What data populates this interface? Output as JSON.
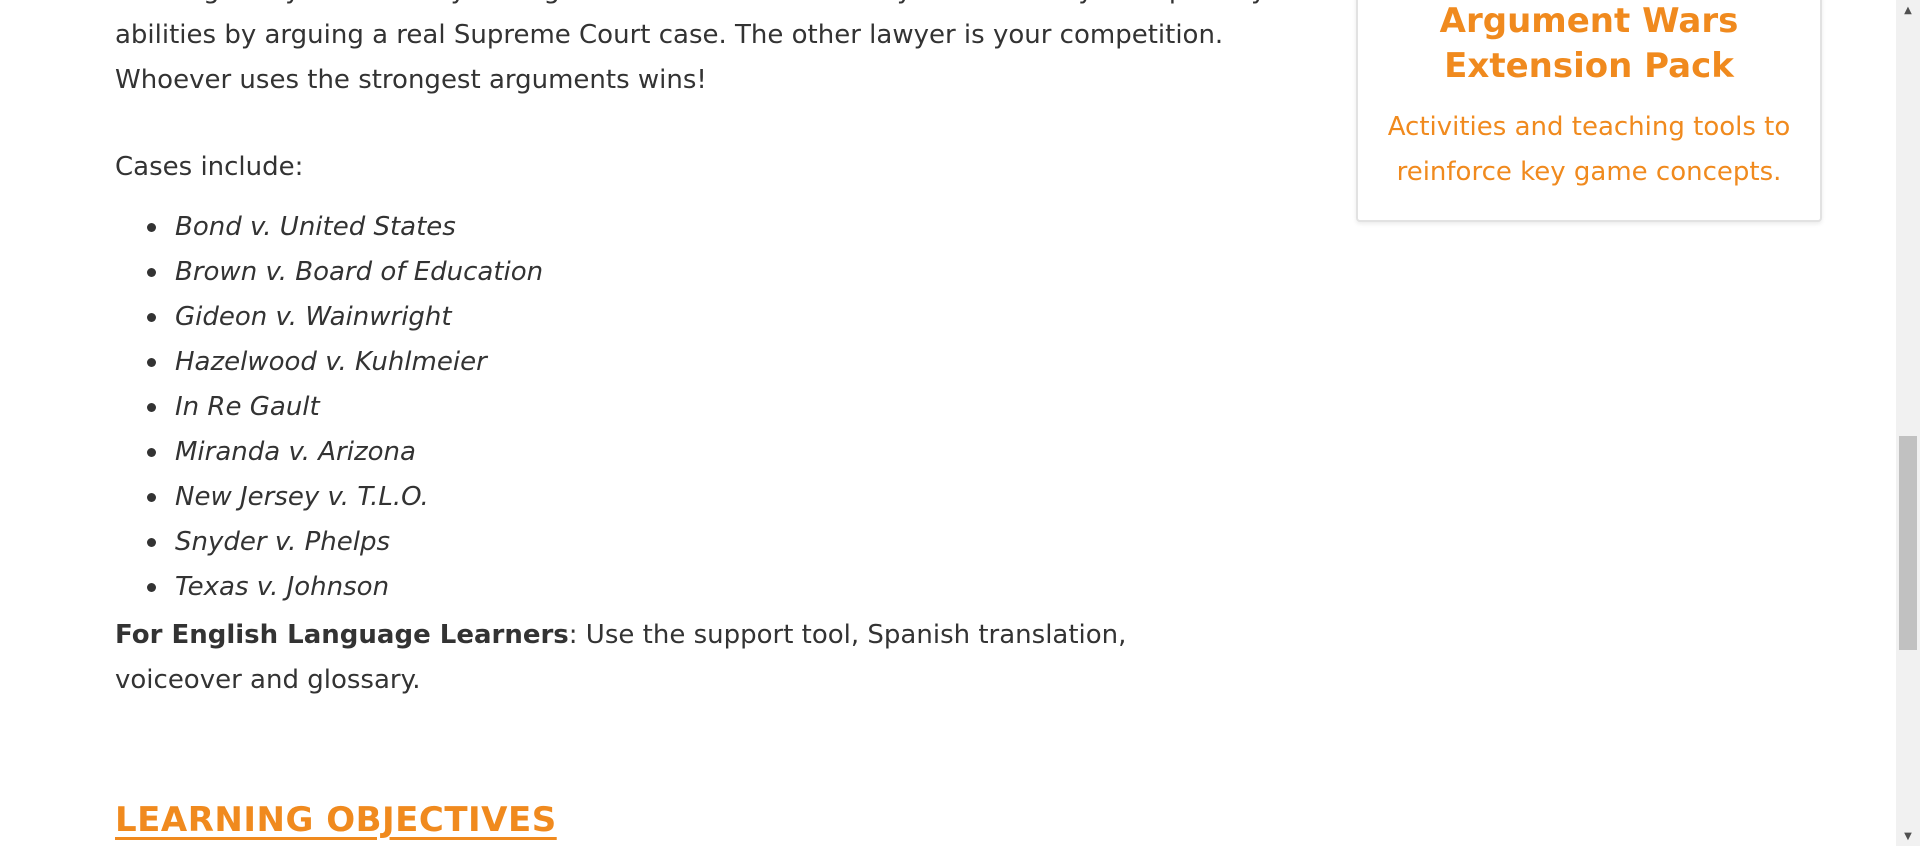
{
  "intro": {
    "clipped_line": "In this game you will test your argumentation skills as a lawyer. You will try to improve your",
    "line1": "abilities by arguing a real Supreme Court case. The other lawyer is your competition.",
    "line2": "Whoever uses the strongest arguments wins!"
  },
  "cases_label": "Cases include:",
  "cases": [
    "Bond v. United States",
    "Brown v. Board of Education",
    "Gideon v. Wainwright",
    "Hazelwood v. Kuhlmeier",
    "In Re Gault",
    "Miranda v. Arizona",
    "New Jersey v. T.L.O.",
    "Snyder v. Phelps",
    "Texas v. Johnson"
  ],
  "ell": {
    "bold": "For English Language Learners",
    "rest": ": Use the support tool, Spanish translation, voiceover and glossary."
  },
  "learning_objectives_heading": "LEARNING OBJECTIVES",
  "sidebar_card": {
    "title": "Argument Wars Extension Pack",
    "description": "Activities and teaching tools to reinforce key game concepts."
  },
  "scrollbar": {
    "up_icon": "triangle-up",
    "down_icon": "triangle-down",
    "position_fraction": 0.52
  },
  "colors": {
    "accent": "#f08a1e",
    "text": "#333333"
  }
}
